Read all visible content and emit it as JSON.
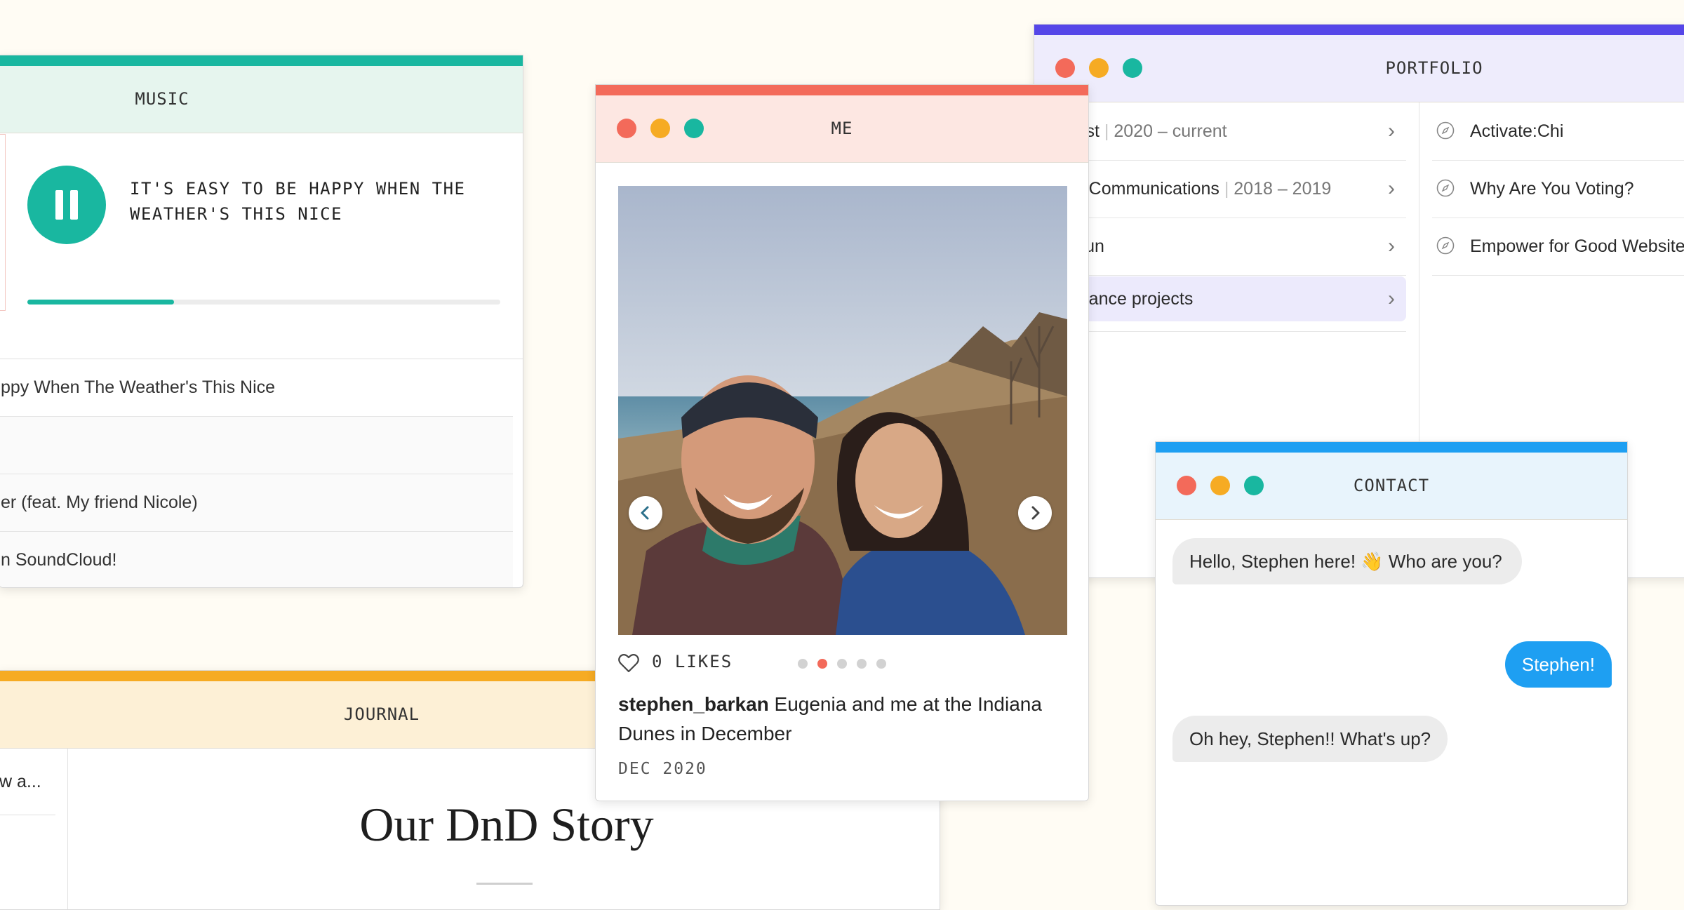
{
  "music": {
    "title": "MUSIC",
    "now_playing": "IT'S EASY TO BE HAPPY WHEN THE WEATHER'S THIS NICE",
    "progress": 0.31,
    "tracks": [
      "ppy When The Weather's This Nice",
      "",
      "er (feat. My friend Nicole)",
      "n SoundCloud!"
    ]
  },
  "journal": {
    "title": "JOURNAL",
    "sidebar_item": "w a...",
    "heading": "Our DnD Story"
  },
  "me": {
    "title": "ME",
    "likes": "0 LIKES",
    "photo_count": 5,
    "active_photo": 2,
    "username": "stephen_barkan",
    "caption": "Eugenia and me at the Indiana Dunes in December",
    "date": "DEC 2020"
  },
  "portfolio": {
    "title": "PORTFOLIO",
    "items": [
      {
        "name": "Doist",
        "sep": "|",
        "years": "2020 – current"
      },
      {
        "name": "NK Communications",
        "sep": "|",
        "years": "2018 – 2019"
      },
      {
        "name": "or fun",
        "sep": "",
        "years": ""
      },
      {
        "name": "reelance projects",
        "sep": "",
        "years": ""
      }
    ],
    "active_item": 3,
    "links": [
      "Activate:Chi",
      "Why Are You Voting?",
      "Empower for Good Website"
    ]
  },
  "contact": {
    "title": "CONTACT",
    "messages": [
      {
        "from": "them",
        "text": "Hello, Stephen here! 👋 Who are you?"
      },
      {
        "from": "me",
        "text": "Stephen!"
      },
      {
        "from": "them",
        "text": "Oh hey, Stephen!! What's up?"
      }
    ]
  },
  "colors": {
    "music_accent": "#19b7a0",
    "journal_accent": "#f6ab23",
    "me_accent": "#f36a5a",
    "portfolio_accent": "#5546e8",
    "contact_accent": "#1e9ff2"
  }
}
